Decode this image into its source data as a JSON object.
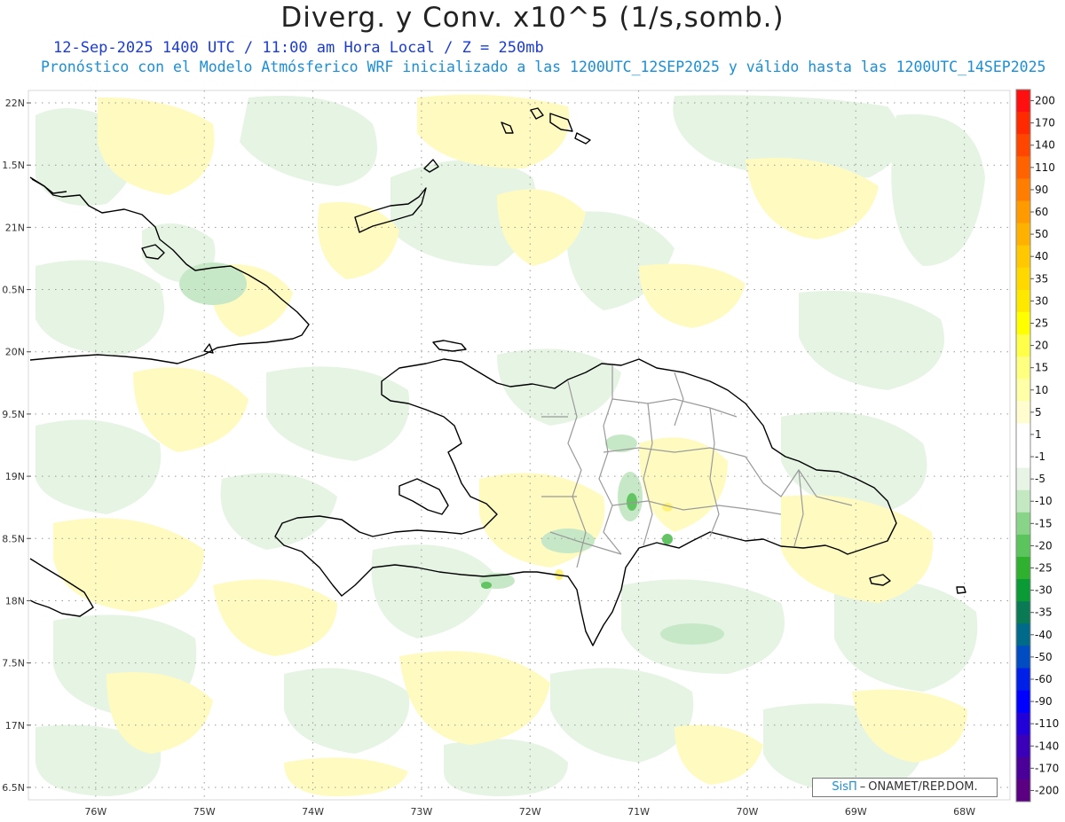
{
  "header": {
    "title": "Diverg. y Conv. x10^5 (1/s,somb.)",
    "valid_line": "12-Sep-2025  1400 UTC / 11:00 am Hora Local / Z = 250mb",
    "model_line": "Pronóstico con el Modelo Atmósferico WRF inicializado a las 1200UTC_12SEP2025 y válido hasta las  1200UTC_14SEP2025"
  },
  "map": {
    "lat_labels": [
      "22N",
      "1.5N",
      "21N",
      "0.5N",
      "20N",
      "9.5N",
      "19N",
      "8.5N",
      "18N",
      "7.5N",
      "17N",
      "6.5N"
    ],
    "lon_labels": [
      "76W",
      "75W",
      "74W",
      "73W",
      "72W",
      "71W",
      "70W",
      "69W",
      "68W"
    ],
    "lat_range": [
      16.5,
      22.0
    ],
    "lon_range": [
      -76.6,
      -67.6
    ],
    "grid": "dotted",
    "field_colors": {
      "weak_divergence": "#fffbc0",
      "weak_convergence": "#e6f4e4",
      "moderate_convergence": "#c6e8c6",
      "strong_convergence": "#62c462",
      "coastline": "#000000",
      "province_borders": "#9a9a9a"
    }
  },
  "legend": {
    "labels": [
      "200",
      "170",
      "140",
      "110",
      "90",
      "60",
      "50",
      "40",
      "35",
      "30",
      "25",
      "20",
      "15",
      "10",
      "5",
      "1",
      "-1",
      "-5",
      "-10",
      "-15",
      "-20",
      "-25",
      "-30",
      "-35",
      "-40",
      "-50",
      "-60",
      "-90",
      "-110",
      "-140",
      "-170",
      "-200"
    ],
    "colors": [
      "#ff1010",
      "#ff2a00",
      "#ff4600",
      "#ff6200",
      "#ff7d00",
      "#ff9a00",
      "#ffb100",
      "#ffc800",
      "#ffd800",
      "#ffe800",
      "#ffff00",
      "#ffff4a",
      "#ffff80",
      "#ffffa8",
      "#fffdd0",
      "#ffffff",
      "#ffffff",
      "#e8f5e6",
      "#c4e9c2",
      "#88d488",
      "#5cc45c",
      "#2fb02f",
      "#0a9a36",
      "#0a7a55",
      "#006a8a",
      "#004cc0",
      "#0020e8",
      "#0000ff",
      "#2200d8",
      "#3a00b8",
      "#4a0098",
      "#5a0080"
    ]
  },
  "credit": {
    "brand": "SisΠ",
    "separator": "–",
    "agency": "ONAMET/REP.DOM."
  }
}
